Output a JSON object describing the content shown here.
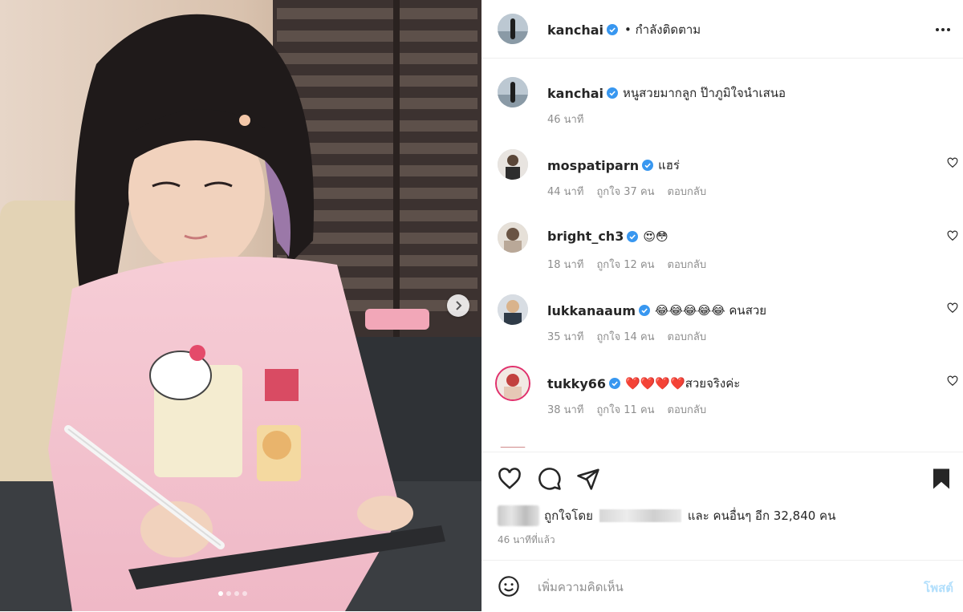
{
  "post": {
    "username": "kanchai",
    "follow_status": "• กำลังติดตาม",
    "caption": "หนูสวยมากลูก ป๊าภูมิใจนำเสนอ",
    "caption_time": "46 นาที",
    "image_dots": 4,
    "active_dot": 0
  },
  "comments": [
    {
      "username": "mospatiparn",
      "text": "แฮร่",
      "time": "44 นาที",
      "likes": "ถูกใจ 37 คน",
      "reply": "ตอบกลับ"
    },
    {
      "username": "bright_ch3",
      "text": "😍😳",
      "time": "18 นาที",
      "likes": "ถูกใจ 12 คน",
      "reply": "ตอบกลับ"
    },
    {
      "username": "lukkanaaum",
      "text": "😂😂😂😂😂 คนสวย",
      "time": "35 นาที",
      "likes": "ถูกใจ 14 คน",
      "reply": "ตอบกลับ"
    },
    {
      "username": "tukky66",
      "text": "❤️❤️❤️❤️สวยจริงค่ะ",
      "time": "38 นาที",
      "likes": "ถูกใจ 11 คน",
      "reply": "ตอบกลับ"
    }
  ],
  "likes_bar": {
    "prefix": "ถูกใจโดย",
    "suffix": "และ คนอื่นๆ อีก 32,840 คน",
    "time_ago": "46 นาทีที่แล้ว"
  },
  "comment_box": {
    "placeholder": "เพิ่มความคิดเห็น",
    "post_label": "โพสต์"
  },
  "colors": {
    "verified": "#3897f0",
    "text": "#262626",
    "muted": "#8e8e8e",
    "post_disabled": "#b2dffc"
  },
  "icons": [
    "verified-badge-icon",
    "more-options-icon",
    "heart-icon",
    "comment-icon",
    "share-icon",
    "bookmark-icon",
    "emoji-icon",
    "chevron-right-icon"
  ]
}
